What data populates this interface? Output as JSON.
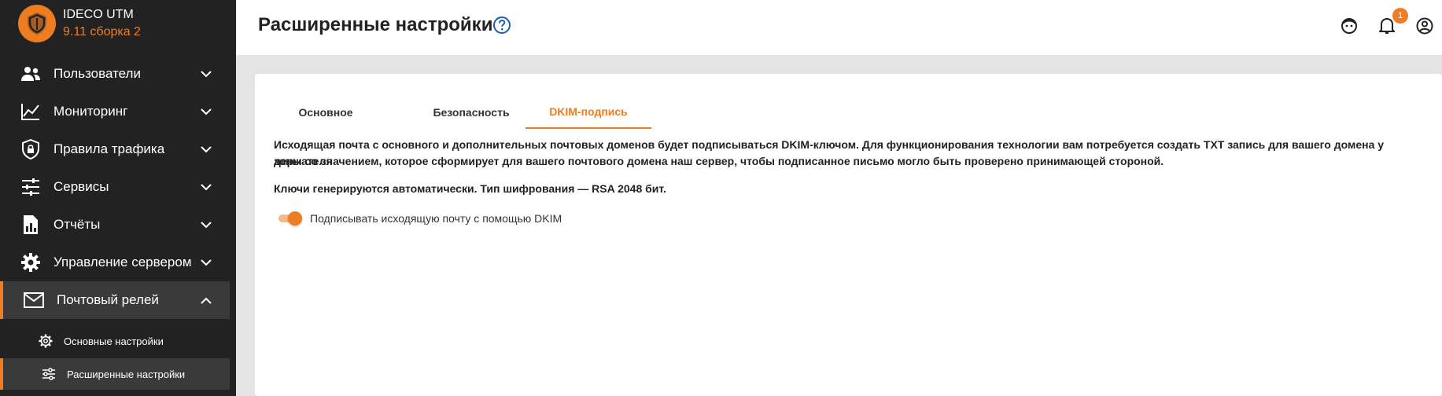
{
  "brand": {
    "name": "IDECO UTM",
    "version": "9.11 сборка 2"
  },
  "sidebar": {
    "items": [
      {
        "label": "Пользователи",
        "icon": "users-icon"
      },
      {
        "label": "Мониторинг",
        "icon": "chart-line-icon"
      },
      {
        "label": "Правила трафика",
        "icon": "shield-lock-icon"
      },
      {
        "label": "Сервисы",
        "icon": "sliders-icon"
      },
      {
        "label": "Отчёты",
        "icon": "report-icon"
      },
      {
        "label": "Управление сервером",
        "icon": "gear-icon"
      },
      {
        "label": "Почтовый релей",
        "icon": "mail-icon",
        "expanded": true
      }
    ],
    "subitems": [
      {
        "label": "Основные настройки",
        "icon": "gear-icon"
      },
      {
        "label": "Расширенные настройки",
        "icon": "sliders-icon",
        "active": true
      }
    ]
  },
  "header": {
    "title": "Расширенные настройки",
    "notification_count": "1"
  },
  "tabs": [
    {
      "label": "Основное"
    },
    {
      "label": "Безопасность"
    },
    {
      "label": "DKIM-подпись",
      "active": true
    }
  ],
  "content": {
    "paragraph1_line1": "Исходящая почта с основного и дополнительных почтовых доменов будет подписываться DKIM-ключом. Для функционирования технологии вам потребуется создать TXT запись для вашего домена у держателя",
    "paragraph1_line2": "зоны со значением, которое сформирует для вашего почтового домена наш сервер, чтобы подписанное письмо могло быть проверено принимающей стороной.",
    "paragraph2": "Ключи генерируются автоматически. Тип шифрования — RSA 2048 бит.",
    "toggle_label": "Подписывать исходящую почту с помощью DKIM",
    "toggle_on": true
  },
  "colors": {
    "accent": "#ee7d22",
    "sidebar_bg": "#222222",
    "help_icon": "#1a5fb4"
  }
}
